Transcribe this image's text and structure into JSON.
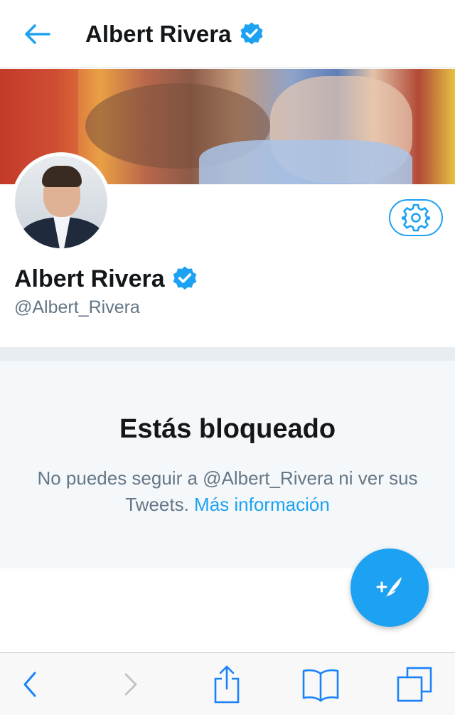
{
  "header": {
    "title": "Albert Rivera",
    "back_icon": "arrow-left-icon",
    "verified_icon": "verified-badge-icon"
  },
  "profile": {
    "name": "Albert Rivera",
    "handle": "@Albert_Rivera",
    "settings_icon": "gear-icon"
  },
  "blocked": {
    "title": "Estás bloqueado",
    "message": "No puedes seguir a @Albert_Rivera ni ver sus Tweets.",
    "link_label": "Más información"
  },
  "compose": {
    "icon": "compose-tweet-icon"
  },
  "toolbar": {
    "items": [
      "back-icon",
      "forward-icon",
      "share-icon",
      "bookmarks-icon",
      "tabs-icon"
    ]
  },
  "colors": {
    "accent": "#1da1f2",
    "text_primary": "#14171a",
    "text_secondary": "#657786",
    "blocked_bg": "#f5f8fa",
    "divider": "#e6ecf0"
  }
}
